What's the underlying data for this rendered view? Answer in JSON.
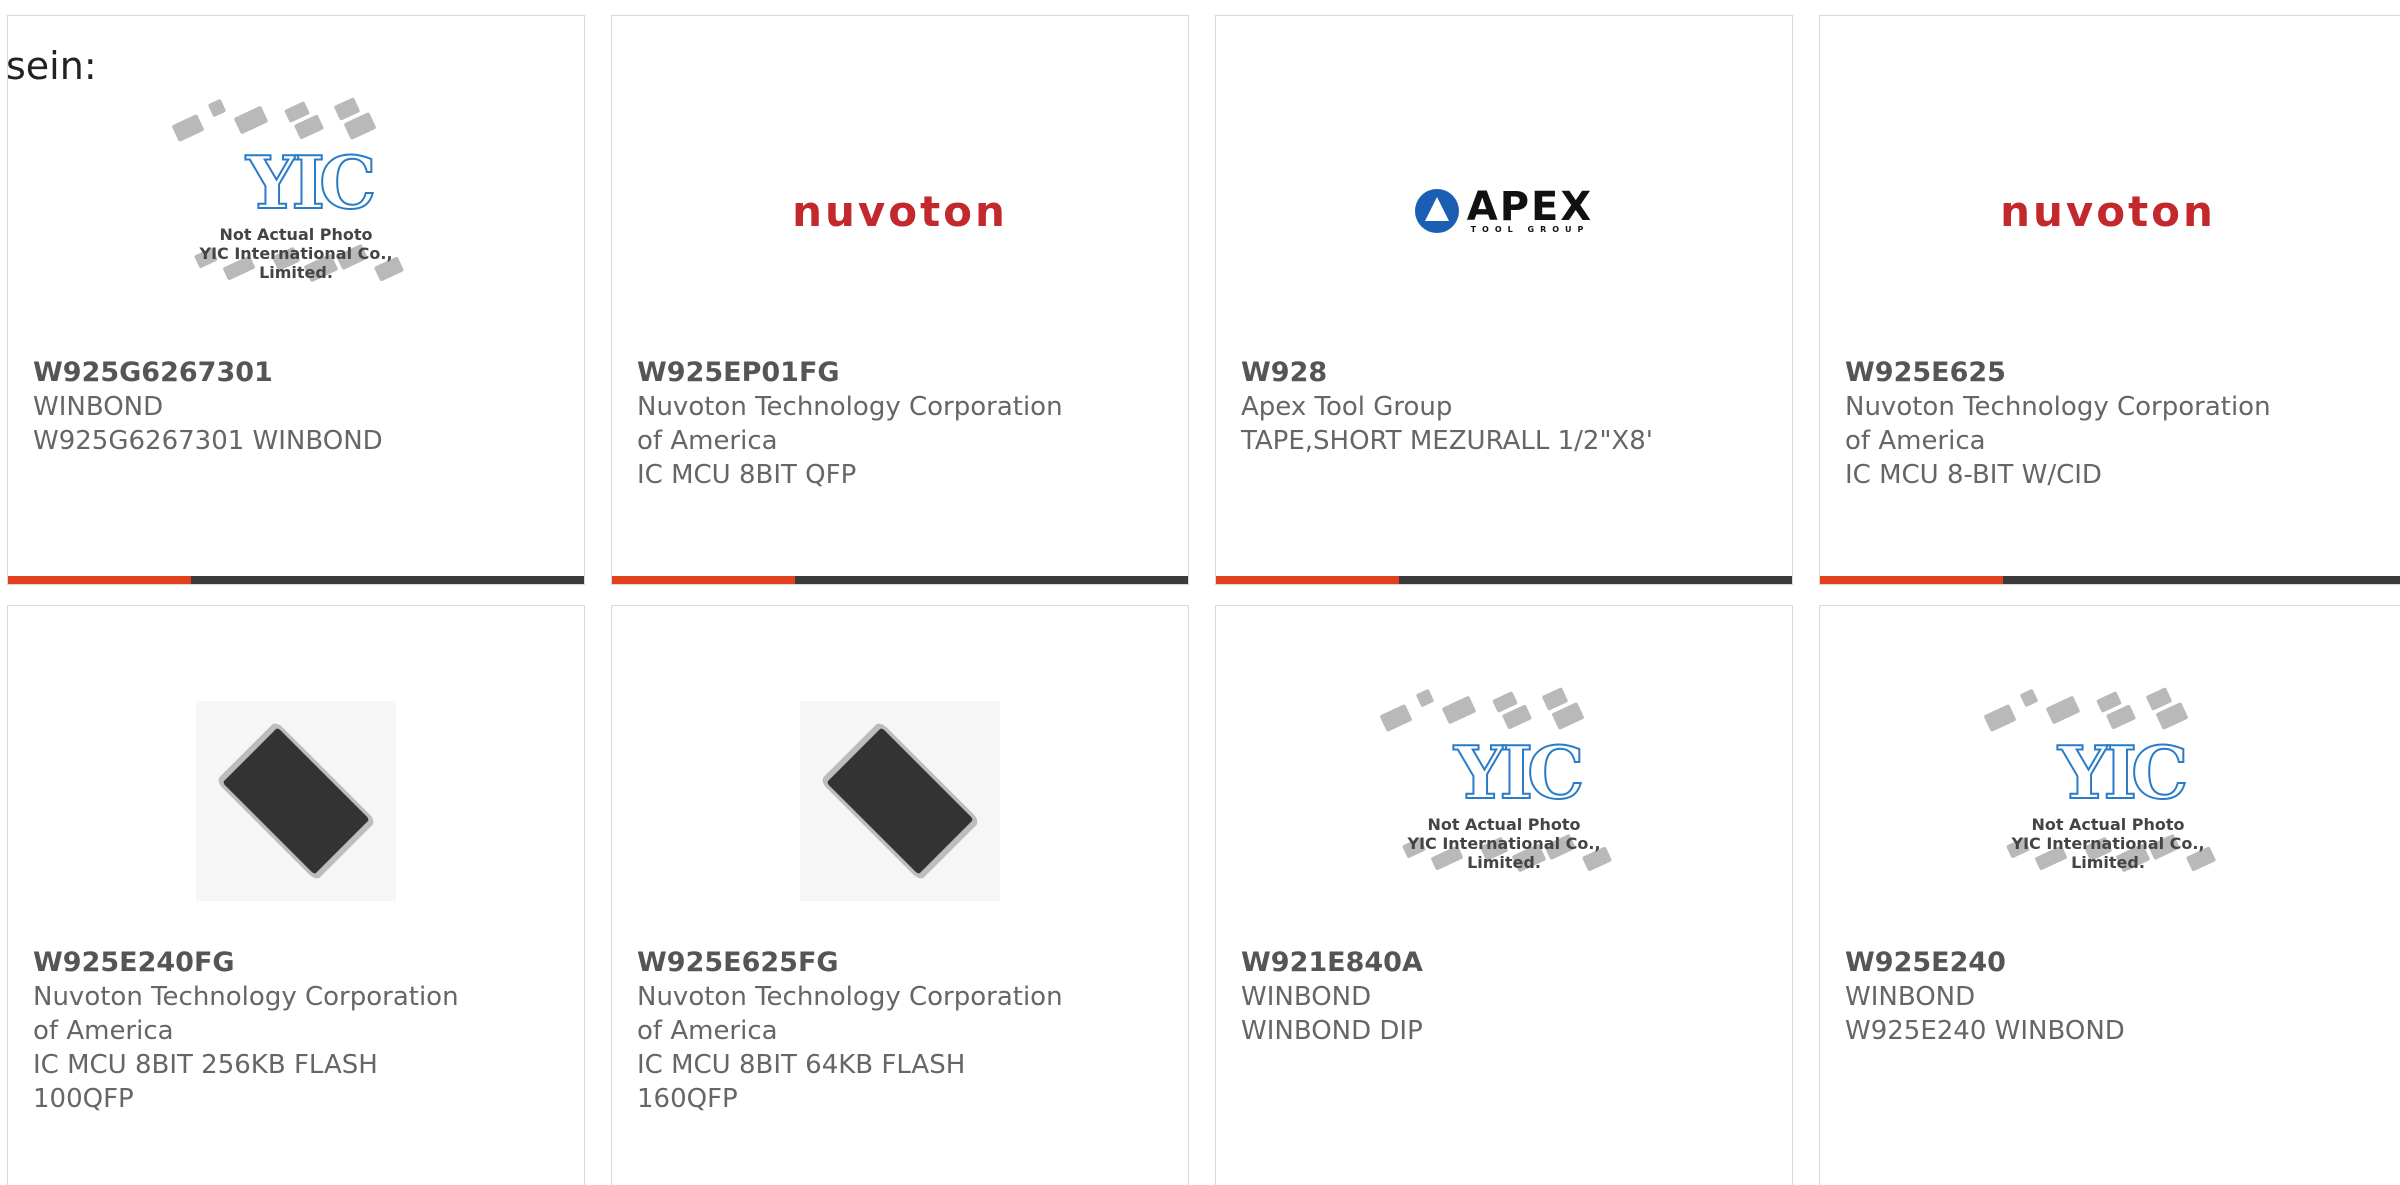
{
  "prefix_text": "sein:",
  "placeholder": {
    "logo_text": "YIC",
    "line1": "Not Actual Photo",
    "line2": "YIC International Co., Limited."
  },
  "brands": {
    "nuvoton": "nuvoTon",
    "apex": "APEX",
    "apex_sub": "TOOL GROUP"
  },
  "colors": {
    "accent": "#e2401c",
    "bar": "#3a3a3a",
    "nuvoton_red": "#c3282c"
  },
  "products": [
    {
      "part": "W925G6267301",
      "mfr": "WINBOND",
      "desc": [
        "W925G6267301 WINBOND"
      ],
      "image": "placeholder"
    },
    {
      "part": "W925EP01FG",
      "mfr": [
        "Nuvoton Technology Corporation",
        "of America"
      ],
      "desc": [
        "IC MCU 8BIT QFP"
      ],
      "image": "nuvoton-logo"
    },
    {
      "part": "W928",
      "mfr": "Apex Tool Group",
      "desc": [
        "TAPE,SHORT MEZURALL 1/2\"X8'"
      ],
      "image": "apex-logo"
    },
    {
      "part": "W925E625",
      "mfr": [
        "Nuvoton Technology Corporation",
        "of America"
      ],
      "desc": [
        "IC MCU 8-BIT W/CID"
      ],
      "image": "nuvoton-logo"
    },
    {
      "part": "W925E240FG",
      "mfr": [
        "Nuvoton Technology Corporation",
        "of America"
      ],
      "desc": [
        "IC MCU 8BIT 256KB FLASH",
        "100QFP"
      ],
      "image": "qfp-chip"
    },
    {
      "part": "W925E625FG",
      "mfr": [
        "Nuvoton Technology Corporation",
        "of America"
      ],
      "desc": [
        "IC MCU 8BIT 64KB FLASH",
        "160QFP"
      ],
      "image": "qfp-chip"
    },
    {
      "part": "W921E840A",
      "mfr": "WINBOND",
      "desc": [
        "WINBOND DIP"
      ],
      "image": "placeholder"
    },
    {
      "part": "W925E240",
      "mfr": "WINBOND",
      "desc": [
        "W925E240 WINBOND"
      ],
      "image": "placeholder"
    }
  ]
}
